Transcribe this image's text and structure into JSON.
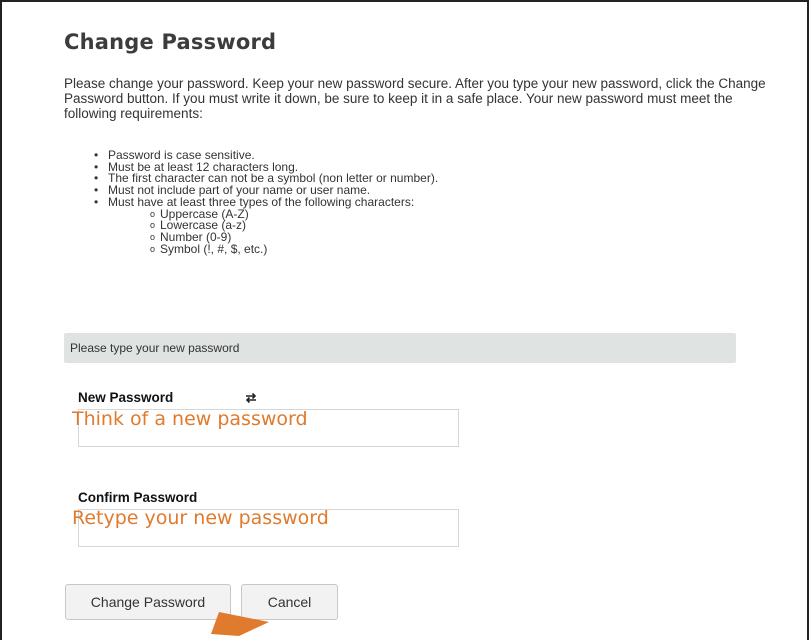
{
  "page": {
    "title": "Change Password",
    "intro": "Please change your password. Keep your new password secure. After you type your new password, click the Change Password button. If you must write it down, be sure to keep it in a safe place. Your new password must meet the following requirements:"
  },
  "requirements": {
    "items": [
      "Password is case sensitive.",
      "Must be at least 12 characters long.",
      "The first character can not be a symbol (non letter or number).",
      "Must not include part of your name or user name.",
      "Must have at least three types of the following characters:"
    ],
    "char_types": [
      "Uppercase (A-Z)",
      "Lowercase (a-z)",
      "Number (0-9)",
      "Symbol (!, #, $, etc.)"
    ]
  },
  "form": {
    "banner": "Please type your new password",
    "new_password": {
      "label": "New Password",
      "value": "",
      "icon": "swap-icon"
    },
    "confirm_password": {
      "label": "Confirm Password",
      "value": ""
    }
  },
  "annotations": {
    "new_hint": "Think of a new password",
    "confirm_hint": "Retype your new password",
    "color": "#e07a2c"
  },
  "buttons": {
    "change_label": "Change Password",
    "cancel_label": "Cancel"
  }
}
